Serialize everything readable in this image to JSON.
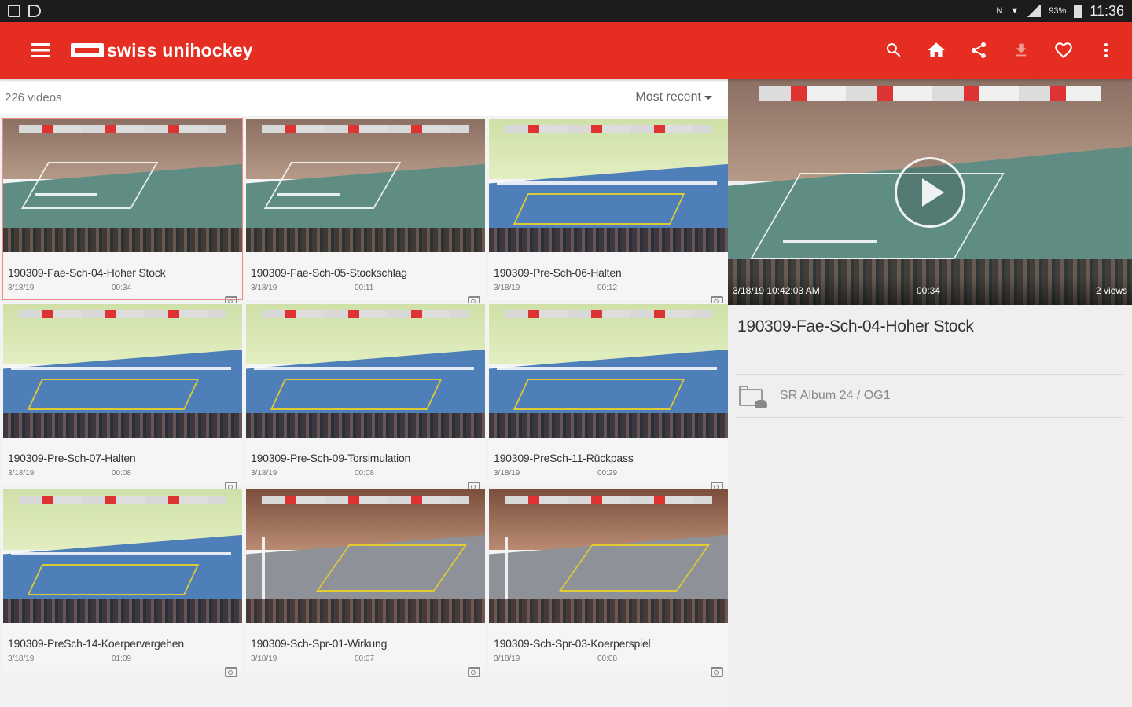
{
  "statusbar": {
    "percent": "93%",
    "time": "11:36"
  },
  "app": {
    "brand": "swiss unihockey"
  },
  "list": {
    "count_label": "226 videos",
    "sort_label": "Most recent",
    "videos": [
      {
        "title": "190309-Fae-Sch-04-Hoher Stock",
        "date": "3/18/19",
        "duration": "00:34",
        "style": "green"
      },
      {
        "title": "190309-Fae-Sch-05-Stockschlag",
        "date": "3/18/19",
        "duration": "00:11",
        "style": "green"
      },
      {
        "title": "190309-Pre-Sch-06-Halten",
        "date": "3/18/19",
        "duration": "00:12",
        "style": "blue"
      },
      {
        "title": "190309-Pre-Sch-07-Halten",
        "date": "3/18/19",
        "duration": "00:08",
        "style": "blue"
      },
      {
        "title": "190309-Pre-Sch-09-Torsimulation",
        "date": "3/18/19",
        "duration": "00:08",
        "style": "blue"
      },
      {
        "title": "190309-PreSch-11-Rückpass",
        "date": "3/18/19",
        "duration": "00:29",
        "style": "blue"
      },
      {
        "title": "190309-PreSch-14-Koerpervergehen",
        "date": "3/18/19",
        "duration": "01:09",
        "style": "blue"
      },
      {
        "title": "190309-Sch-Spr-01-Wirkung",
        "date": "3/18/19",
        "duration": "00:07",
        "style": "grey"
      },
      {
        "title": "190309-Sch-Spr-03-Koerperspiel",
        "date": "3/18/19",
        "duration": "00:08",
        "style": "grey"
      }
    ]
  },
  "detail": {
    "timestamp": "3/18/19 10:42:03 AM",
    "duration": "00:34",
    "views": "2 views",
    "title": "190309-Fae-Sch-04-Hoher Stock",
    "album": "SR Album 24 / OG1"
  },
  "colors": {
    "toolbar": "#e62d21",
    "selected_border": "#f08a84"
  }
}
